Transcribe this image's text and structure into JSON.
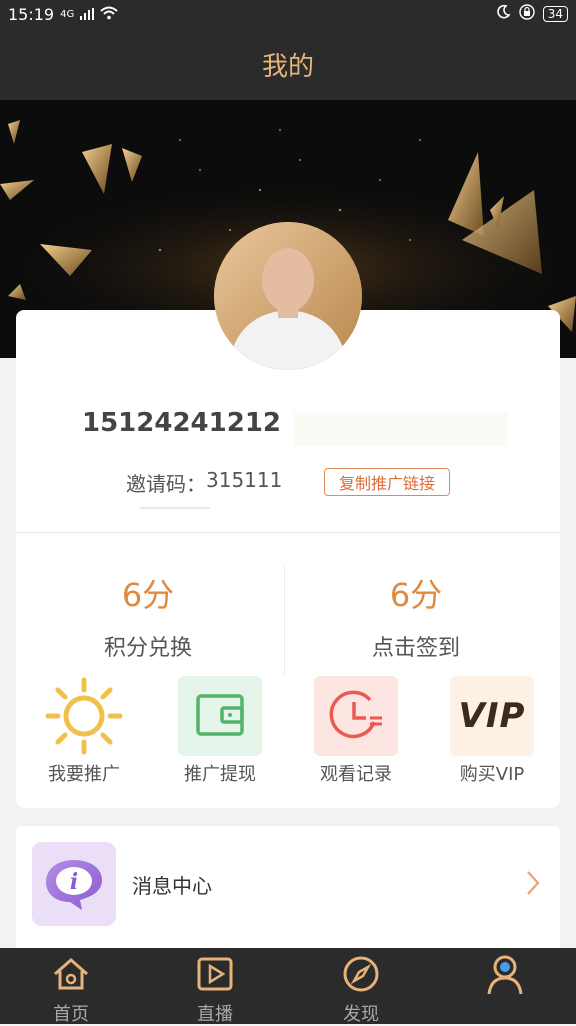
{
  "status_bar": {
    "time": "15:19",
    "network": "4G",
    "battery": "34"
  },
  "header": {
    "title": "我的"
  },
  "profile": {
    "phone": "15124241212",
    "invite_label": "邀请码：",
    "invite_code": "315111",
    "copy_button": "复制推广链接"
  },
  "stats": [
    {
      "value": "6分",
      "label": "积分兑换"
    },
    {
      "value": "6分",
      "label": "点击签到"
    }
  ],
  "features": [
    {
      "label": "我要推广",
      "icon": "sun-icon"
    },
    {
      "label": "推广提现",
      "icon": "wallet-icon"
    },
    {
      "label": "观看记录",
      "icon": "history-icon"
    },
    {
      "label": "购买VIP",
      "icon": "vip-icon",
      "icon_text": "VIP"
    }
  ],
  "menu": {
    "message_center": "消息中心"
  },
  "tabbar": [
    {
      "label": "首页",
      "icon": "home-icon"
    },
    {
      "label": "直播",
      "icon": "play-icon"
    },
    {
      "label": "发现",
      "icon": "compass-icon"
    },
    {
      "label": "",
      "icon": "profile-icon"
    }
  ],
  "colors": {
    "accent": "#e7b37a",
    "orange": "#e08a3f",
    "dark": "#2b2b2b"
  }
}
